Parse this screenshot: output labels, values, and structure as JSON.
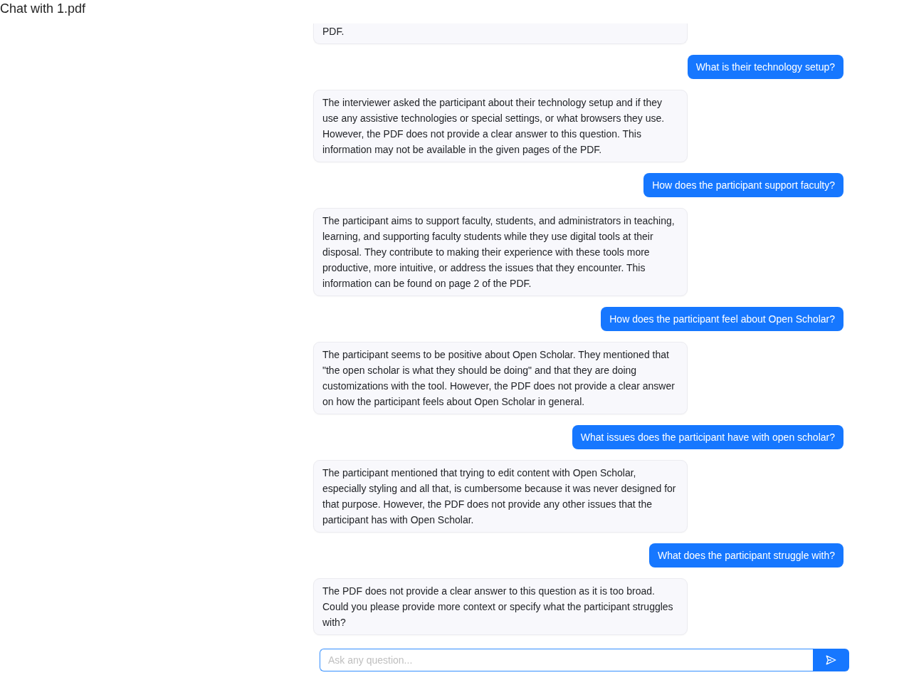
{
  "title": "Chat with 1.pdf",
  "messages": [
    {
      "kind": "answer",
      "cut_off": true,
      "text": "PDF."
    },
    {
      "kind": "question",
      "cut_off": false,
      "text": "What is their technology setup?"
    },
    {
      "kind": "answer",
      "cut_off": false,
      "text": "The interviewer asked the participant about their technology setup and if they use any assistive technologies or special settings, or what browsers they use. However, the PDF does not provide a clear answer to this question. This information may not be available in the given pages of the PDF."
    },
    {
      "kind": "question",
      "cut_off": false,
      "text": "How does the participant support faculty?"
    },
    {
      "kind": "answer",
      "cut_off": false,
      "text": "The participant aims to support faculty, students, and administrators in teaching, learning, and supporting faculty students while they use digital tools at their disposal. They contribute to making their experience with these tools more productive, more intuitive, or address the issues that they encounter. This information can be found on page 2 of the PDF."
    },
    {
      "kind": "question",
      "cut_off": false,
      "text": "How does the participant feel about Open Scholar?"
    },
    {
      "kind": "answer",
      "cut_off": false,
      "text": "The participant seems to be positive about Open Scholar. They mentioned that \"the open scholar is what they should be doing\" and that they are doing customizations with the tool. However, the PDF does not provide a clear answer on how the participant feels about Open Scholar in general."
    },
    {
      "kind": "question",
      "cut_off": false,
      "text": "What issues does the participant have with open scholar?"
    },
    {
      "kind": "answer",
      "cut_off": false,
      "text": "The participant mentioned that trying to edit content with Open Scholar, especially styling and all that, is cumbersome because it was never designed for that purpose. However, the PDF does not provide any other issues that the participant has with Open Scholar."
    },
    {
      "kind": "question",
      "cut_off": false,
      "text": "What does the participant struggle with?"
    },
    {
      "kind": "answer",
      "cut_off": false,
      "text": "The PDF does not provide a clear answer to this question as it is too broad. Could you please provide more context or specify what the participant struggles with?"
    }
  ],
  "composer": {
    "placeholder": "Ask any question...",
    "focused": true
  }
}
